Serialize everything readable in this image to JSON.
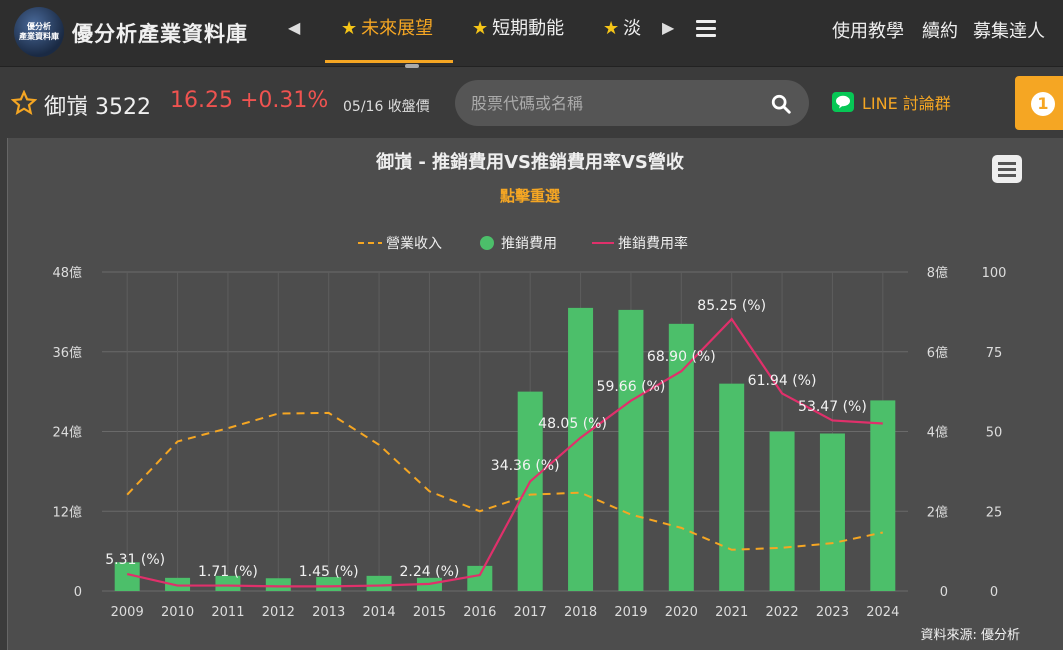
{
  "header": {
    "logo_line1": "優分析",
    "logo_line2": "產業資料庫",
    "brand": "優分析產業資料庫",
    "tabs": [
      {
        "label": "未來展望",
        "active": true
      },
      {
        "label": "短期動能",
        "active": false
      },
      {
        "label": "淡",
        "active": false
      }
    ],
    "links": [
      "使用教學",
      "續約",
      "募集達人"
    ]
  },
  "stock": {
    "name_code": "御嵿 3522",
    "price_change": "16.25 +0.31%",
    "date_label": "05/16 收盤價"
  },
  "search": {
    "placeholder": "股票代碼或名稱"
  },
  "line_group": {
    "label": "LINE 討論群"
  },
  "notification": {
    "count": "1"
  },
  "colors": {
    "accent": "#f5a623",
    "price_up": "#ef5350",
    "bar": "#4cbf6a",
    "rate_line": "#e0306b",
    "revenue_line": "#f5a623"
  },
  "chart_data": {
    "type": "bar",
    "title": "御嵿 - 推銷費用VS推銷費用率VS營收",
    "subtitle": "點擊重選",
    "legend_position": "top-center",
    "legend": [
      "營業收入",
      "推銷費用",
      "推銷費用率"
    ],
    "source": "資料來源: 優分析",
    "categories": [
      "2009",
      "2010",
      "2011",
      "2012",
      "2013",
      "2014",
      "2015",
      "2016",
      "2017",
      "2018",
      "2019",
      "2020",
      "2021",
      "2022",
      "2023",
      "2024"
    ],
    "left_axis": {
      "ticks": [
        "0",
        "12億",
        "24億",
        "36億",
        "48億"
      ],
      "range": [
        0,
        48
      ]
    },
    "right_axis_1": {
      "ticks": [
        "0",
        "2億",
        "4億",
        "6億",
        "8億"
      ],
      "range": [
        0,
        8
      ]
    },
    "right_axis_2": {
      "ticks": [
        "0",
        "25",
        "50",
        "75",
        "100"
      ],
      "range": [
        0,
        100
      ]
    },
    "grid": true,
    "series": [
      {
        "name": "營業收入",
        "type": "line",
        "style": "dashed",
        "axis": "left",
        "unit": "億",
        "values": [
          14.5,
          22.5,
          24.5,
          26.7,
          26.8,
          22.0,
          15.0,
          12.0,
          14.5,
          14.8,
          11.5,
          9.5,
          6.2,
          6.5,
          7.2,
          8.8
        ]
      },
      {
        "name": "推銷費用",
        "type": "bar",
        "axis": "right_1",
        "unit": "億",
        "values": [
          0.72,
          0.33,
          0.38,
          0.32,
          0.35,
          0.38,
          0.33,
          0.63,
          5.0,
          7.1,
          7.05,
          6.7,
          5.2,
          4.0,
          3.95,
          4.78
        ]
      },
      {
        "name": "推銷費用率",
        "type": "line",
        "axis": "right_2",
        "unit": "%",
        "values": [
          5.31,
          1.71,
          1.71,
          1.45,
          1.45,
          1.71,
          2.24,
          5.0,
          34.36,
          48.05,
          59.66,
          68.9,
          85.25,
          61.94,
          53.47,
          52.5
        ]
      }
    ],
    "data_labels": [
      {
        "index": 0,
        "text": "5.31 (%)"
      },
      {
        "index": 2,
        "text": "1.71 (%)"
      },
      {
        "index": 4,
        "text": "1.45 (%)"
      },
      {
        "index": 6,
        "text": "2.24 (%)"
      },
      {
        "index": 8,
        "text": "34.36 (%)"
      },
      {
        "index": 9,
        "text": "48.05 (%)"
      },
      {
        "index": 10,
        "text": "59.66 (%)"
      },
      {
        "index": 11,
        "text": "68.90 (%)"
      },
      {
        "index": 12,
        "text": "85.25 (%)"
      },
      {
        "index": 13,
        "text": "61.94 (%)"
      },
      {
        "index": 14,
        "text": "53.47 (%)"
      }
    ]
  }
}
